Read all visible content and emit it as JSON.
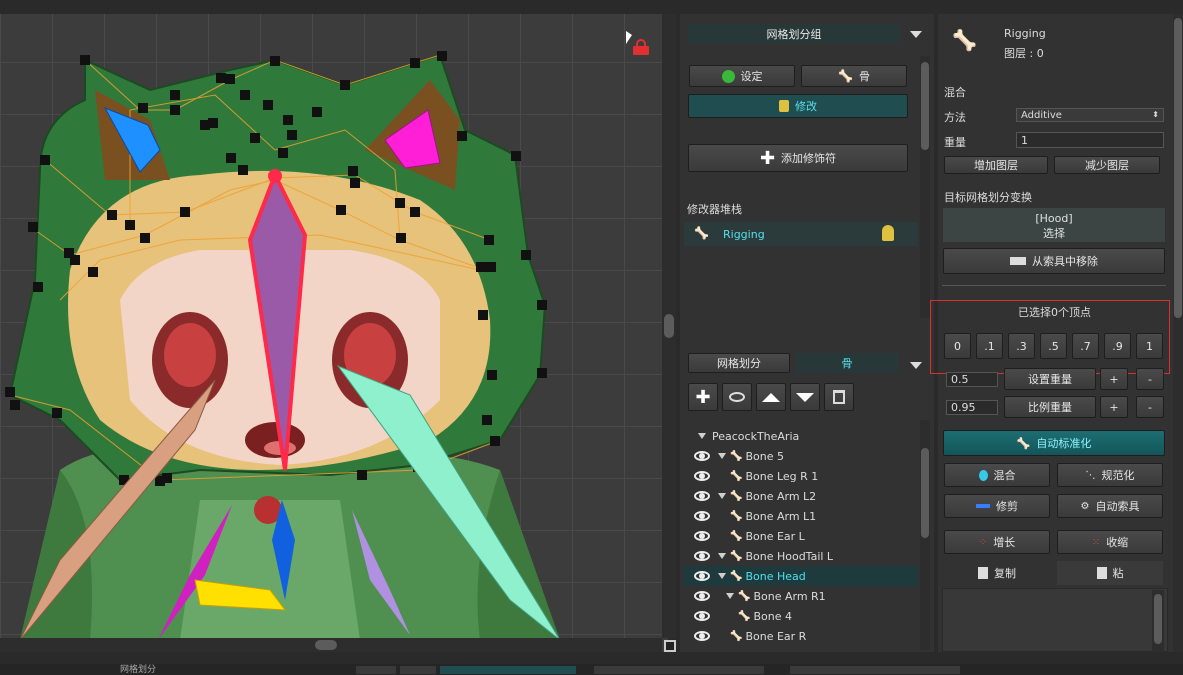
{
  "viewport": {
    "lock_icon": "lock-icon"
  },
  "mesh_group": {
    "title": "网格划分组",
    "btn_settings": "设定",
    "btn_bone": "骨",
    "btn_modify": "修改",
    "btn_add_modifier": "添加修饰符",
    "modifier_stack_label": "修改器堆栈",
    "modifier_item": "Rigging"
  },
  "tabs": {
    "mesh": "网格划分",
    "bone": "骨"
  },
  "tree": {
    "root": "PeacockTheAria",
    "items": [
      {
        "label": "Bone 5"
      },
      {
        "label": "Bone Leg R 1"
      },
      {
        "label": "Bone Arm L2"
      },
      {
        "label": "Bone Arm L1"
      },
      {
        "label": "Bone Ear L"
      },
      {
        "label": "Bone HoodTail L"
      },
      {
        "label": "Bone Head"
      },
      {
        "label": "Bone Arm R1"
      },
      {
        "label": "Bone 4"
      },
      {
        "label": "Bone Ear R"
      }
    ]
  },
  "rigging": {
    "name": "Rigging",
    "layer": "图层 : 0",
    "blend_section": "混合",
    "method_label": "方法",
    "method_value": "Additive",
    "weight_label": "重量",
    "weight_value": "1",
    "btn_add_layer": "增加图层",
    "btn_remove_layer": "减少图层",
    "target_label": "目标网格划分变换",
    "target_name": "[Hood]",
    "target_select": "选择",
    "btn_remove_from_rig": "从索具中移除",
    "selected_vertices": "已选择0个顶点",
    "weight_presets": [
      "0",
      ".1",
      ".3",
      ".5",
      ".7",
      ".9",
      "1"
    ],
    "set_weight_value": "0.5",
    "btn_set_weight": "设置重量",
    "scale_weight_value": "0.95",
    "btn_scale_weight": "比例重量",
    "plus": "+",
    "minus": "-",
    "btn_auto_normalize": "自动标准化",
    "btn_blend": "混合",
    "btn_normalize": "规范化",
    "btn_prune": "修剪",
    "btn_auto_rig": "自动索具",
    "btn_grow": "增长",
    "btn_shrink": "收缩",
    "btn_copy": "复制",
    "btn_paste": "粘"
  },
  "status": {
    "left_label": "网格划分"
  },
  "colors": {
    "accent": "#57e0ee",
    "selection": "#1f3a3c",
    "red_highlight": "#d83030"
  }
}
